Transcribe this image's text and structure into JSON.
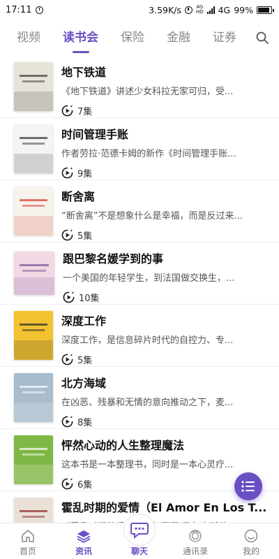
{
  "status_bar": {
    "time": "17:11",
    "net_speed": "3.59K/s",
    "hd": "4G",
    "network": "4G",
    "battery": "99%"
  },
  "tabs": [
    {
      "label": "视频",
      "active": false
    },
    {
      "label": "读书会",
      "active": true
    },
    {
      "label": "保险",
      "active": false
    },
    {
      "label": "金融",
      "active": false
    },
    {
      "label": "证券",
      "active": false
    }
  ],
  "books": [
    {
      "title": "地下铁道",
      "desc": "《地下铁道》讲述少女科拉无家可归，受...",
      "episodes": "7集",
      "cover_bg": "#e8e3d9",
      "cover_fg": "#3a3a3a"
    },
    {
      "title": "时间管理手账",
      "desc": "作者劳拉·范德卡姆的新作《时间管理手账...",
      "episodes": "9集",
      "cover_bg": "#f4f4f4",
      "cover_fg": "#333333"
    },
    {
      "title": "断舍离",
      "desc": "“断舍离”不是想象什么是幸福，而是反过来...",
      "episodes": "5集",
      "cover_bg": "#f7f3ec",
      "cover_fg": "#d63a2a"
    },
    {
      "title": "跟巴黎名媛学到的事",
      "desc": "一个美国的年轻学生，到法国做交换生，...",
      "episodes": "10集",
      "cover_bg": "#f0d9e4",
      "cover_fg": "#7a4f9b"
    },
    {
      "title": "深度工作",
      "desc": "深度工作，是信息碎片时代的自控力、专...",
      "episodes": "5集",
      "cover_bg": "#f2c230",
      "cover_fg": "#2a2a2a"
    },
    {
      "title": "北方海域",
      "desc": "在凶恶、残暴和无情的意向推动之下，麦...",
      "episodes": "8集",
      "cover_bg": "#a9bccc",
      "cover_fg": "#ffffff"
    },
    {
      "title": "怦然心动的人生整理魔法",
      "desc": "这本书是一本整理书，同时是一本心灵疗...",
      "episodes": "6集",
      "cover_bg": "#7fb845",
      "cover_fg": "#ffffff"
    },
    {
      "title": "霍乱时期的爱情（El Amor En Los T...",
      "desc": "《霍乱时期的爱情》是加西亚·马尔克斯获...",
      "episodes": "",
      "cover_bg": "#e9e1d6",
      "cover_fg": "#8a2b2b"
    }
  ],
  "bottom_nav": [
    {
      "label": "首页",
      "icon": "home-icon",
      "active": false
    },
    {
      "label": "资讯",
      "icon": "layers-icon",
      "active": true
    },
    {
      "label": "聊天",
      "icon": "chat-bubble-icon",
      "active": false
    },
    {
      "label": "通讯录",
      "icon": "contacts-icon",
      "active": false
    },
    {
      "label": "我的",
      "icon": "profile-icon",
      "active": false
    }
  ],
  "colors": {
    "accent": "#6a4fc3"
  }
}
